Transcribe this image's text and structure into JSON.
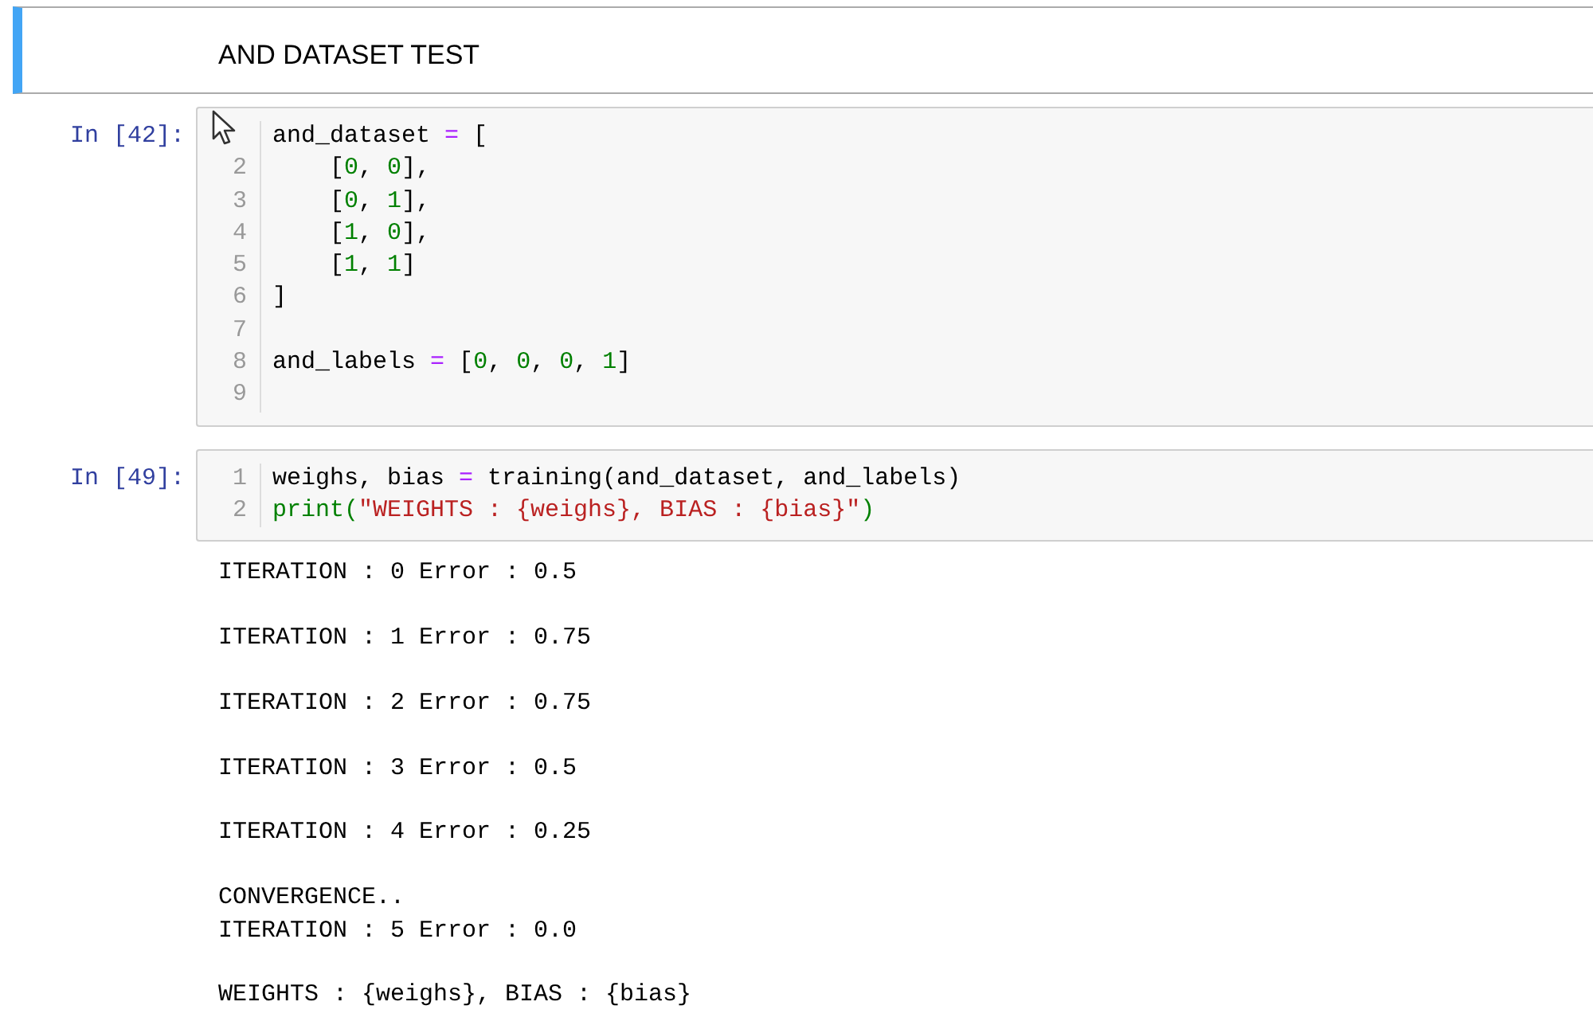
{
  "markdown_cell": {
    "text": "AND DATASET TEST",
    "selected": true
  },
  "code_cells": [
    {
      "prompt": "In [42]:",
      "cursor_over_gutter": true,
      "lines": [
        {
          "tokens": [
            {
              "kind": "plain",
              "text": "and_dataset "
            },
            {
              "kind": "op",
              "text": "="
            },
            {
              "kind": "plain",
              "text": " ["
            }
          ]
        },
        {
          "number": "2",
          "tokens": [
            {
              "kind": "plain",
              "text": "    ["
            },
            {
              "kind": "number",
              "text": "0"
            },
            {
              "kind": "plain",
              "text": ", "
            },
            {
              "kind": "number",
              "text": "0"
            },
            {
              "kind": "plain",
              "text": "],"
            }
          ]
        },
        {
          "number": "3",
          "tokens": [
            {
              "kind": "plain",
              "text": "    ["
            },
            {
              "kind": "number",
              "text": "0"
            },
            {
              "kind": "plain",
              "text": ", "
            },
            {
              "kind": "number",
              "text": "1"
            },
            {
              "kind": "plain",
              "text": "],"
            }
          ]
        },
        {
          "number": "4",
          "tokens": [
            {
              "kind": "plain",
              "text": "    ["
            },
            {
              "kind": "number",
              "text": "1"
            },
            {
              "kind": "plain",
              "text": ", "
            },
            {
              "kind": "number",
              "text": "0"
            },
            {
              "kind": "plain",
              "text": "],"
            }
          ]
        },
        {
          "number": "5",
          "tokens": [
            {
              "kind": "plain",
              "text": "    ["
            },
            {
              "kind": "number",
              "text": "1"
            },
            {
              "kind": "plain",
              "text": ", "
            },
            {
              "kind": "number",
              "text": "1"
            },
            {
              "kind": "plain",
              "text": "]"
            }
          ]
        },
        {
          "number": "6",
          "tokens": [
            {
              "kind": "plain",
              "text": "]"
            }
          ]
        },
        {
          "number": "7"
        },
        {
          "number": "8",
          "tokens": [
            {
              "kind": "plain",
              "text": "and_labels "
            },
            {
              "kind": "op",
              "text": "="
            },
            {
              "kind": "plain",
              "text": " ["
            },
            {
              "kind": "number",
              "text": "0"
            },
            {
              "kind": "plain",
              "text": ", "
            },
            {
              "kind": "number",
              "text": "0"
            },
            {
              "kind": "plain",
              "text": ", "
            },
            {
              "kind": "number",
              "text": "0"
            },
            {
              "kind": "plain",
              "text": ", "
            },
            {
              "kind": "number",
              "text": "1"
            },
            {
              "kind": "plain",
              "text": "]"
            }
          ]
        },
        {
          "number": "9"
        }
      ]
    },
    {
      "prompt": "In [49]:",
      "lines": [
        {
          "number": "1",
          "tokens": [
            {
              "kind": "plain",
              "text": "weighs, bias "
            },
            {
              "kind": "op",
              "text": "="
            },
            {
              "kind": "plain",
              "text": " training(and_dataset, and_labels)"
            }
          ]
        },
        {
          "number": "2",
          "tokens": [
            {
              "kind": "builtin",
              "text": "print"
            },
            {
              "kind": "builtin",
              "text": "("
            },
            {
              "kind": "string",
              "text": "\"WEIGHTS : {weighs}, BIAS : {bias}\""
            },
            {
              "kind": "builtin",
              "text": ")"
            }
          ]
        }
      ],
      "output": [
        [
          "ITERATION : 0 Error : 0.5"
        ],
        [
          "ITERATION : 1 Error : 0.75"
        ],
        [
          "ITERATION : 2 Error : 0.75"
        ],
        [
          "ITERATION : 3 Error : 0.5"
        ],
        [
          "ITERATION : 4 Error : 0.25"
        ],
        [
          "CONVERGENCE..",
          "ITERATION : 5 Error : 0.0"
        ],
        [
          "WEIGHTS : {weighs}, BIAS : {bias}"
        ]
      ]
    }
  ]
}
